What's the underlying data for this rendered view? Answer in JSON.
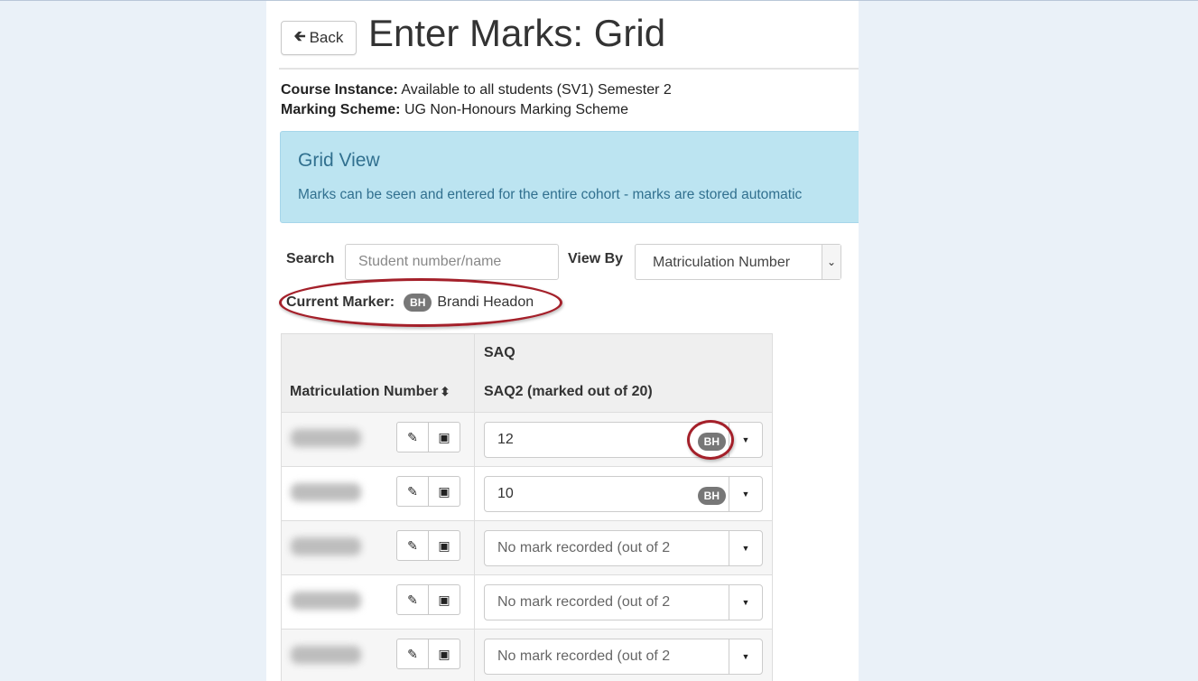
{
  "header": {
    "back_label": "Back",
    "title": "Enter Marks: Grid"
  },
  "meta": {
    "course_instance_label": "Course Instance:",
    "course_instance_value": "Available to all students (SV1) Semester 2",
    "marking_scheme_label": "Marking Scheme:",
    "marking_scheme_value": "UG Non-Honours Marking Scheme"
  },
  "info": {
    "title": "Grid View",
    "text": "Marks can be seen and entered for the entire cohort - marks are stored automatic"
  },
  "controls": {
    "search_label": "Search",
    "search_placeholder": "Student number/name",
    "view_by_label": "View By",
    "view_by_value": "Matriculation Number"
  },
  "current_marker": {
    "label": "Current Marker:",
    "initials": "BH",
    "name": "Brandi Headon"
  },
  "table": {
    "matric_header": "Matriculation Number",
    "group_header": "SAQ",
    "column_header": "SAQ2 (marked out of 20)",
    "rows": [
      {
        "mark": "12",
        "badge": "BH"
      },
      {
        "mark": "10",
        "badge": "BH"
      },
      {
        "mark": "No mark recorded (out of 2"
      },
      {
        "mark": "No mark recorded (out of 2"
      },
      {
        "mark": "No mark recorded (out of 2"
      }
    ]
  },
  "colors": {
    "info_bg": "#bce4f1",
    "info_text": "#31708f",
    "badge_bg": "#777777",
    "highlight_ring": "#a4202a"
  }
}
